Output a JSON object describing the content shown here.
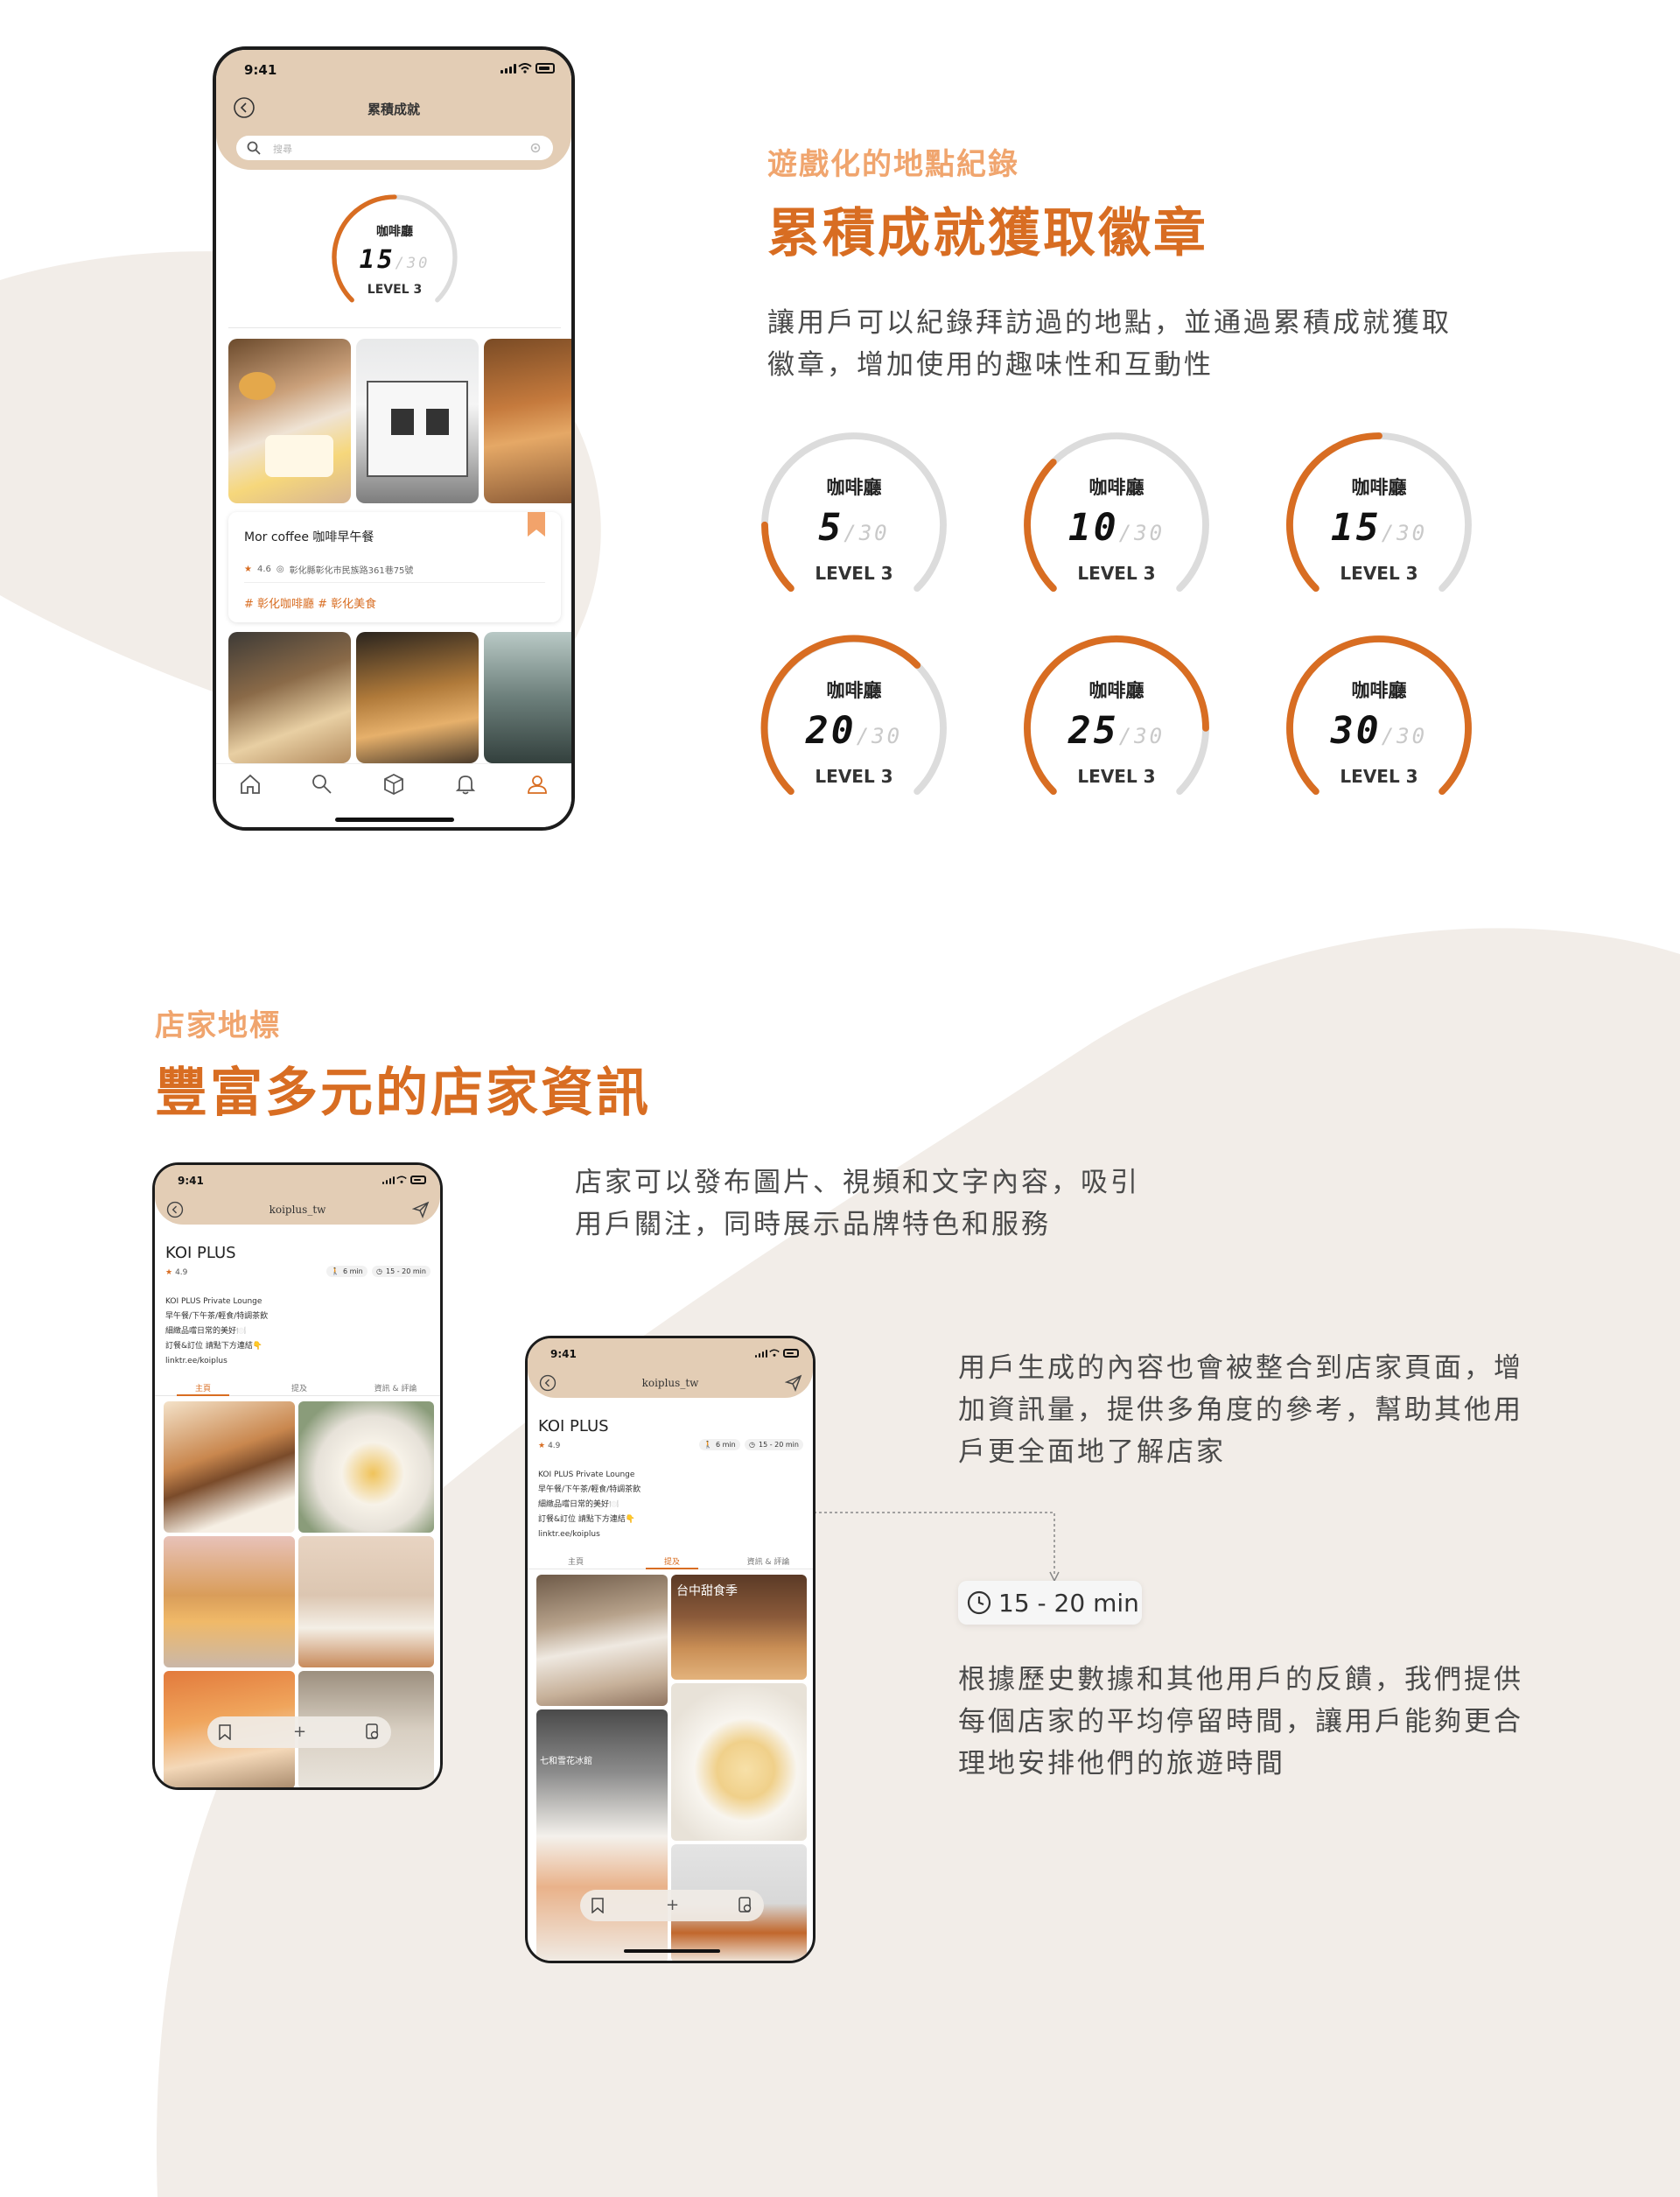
{
  "colors": {
    "accent": "#d86d22",
    "accent_light": "#f0a56e",
    "header_bg": "#e3cdb5",
    "blob": "#f2ede8"
  },
  "section1": {
    "eyebrow": "遊戲化的地點紀錄",
    "title": "累積成就獲取徽章",
    "desc_line1": "讓用戶可以紀錄拜訪過的地點，並通過累積成就獲取",
    "desc_line2": "徽章，增加使用的趣味性和互動性",
    "badges": [
      {
        "label": "咖啡廳",
        "score": "5",
        "total": "/30",
        "level": "LEVEL 3",
        "progress": 0.167
      },
      {
        "label": "咖啡廳",
        "score": "10",
        "total": "/30",
        "level": "LEVEL 3",
        "progress": 0.333
      },
      {
        "label": "咖啡廳",
        "score": "15",
        "total": "/30",
        "level": "LEVEL 3",
        "progress": 0.5
      },
      {
        "label": "咖啡廳",
        "score": "20",
        "total": "/30",
        "level": "LEVEL 3",
        "progress": 0.667
      },
      {
        "label": "咖啡廳",
        "score": "25",
        "total": "/30",
        "level": "LEVEL 3",
        "progress": 0.833
      },
      {
        "label": "咖啡廳",
        "score": "30",
        "total": "/30",
        "level": "LEVEL 3",
        "progress": 1.0
      }
    ]
  },
  "phone1": {
    "time": "9:41",
    "title": "累積成就",
    "search_placeholder": "搜尋",
    "gauge": {
      "label": "咖啡廳",
      "score": "15",
      "total": "/30",
      "level": "LEVEL 3",
      "progress": 0.5
    },
    "card": {
      "name": "Mor coffee 咖啡早午餐",
      "rating": "4.6",
      "address": "彰化縣彰化市民族路361巷75號",
      "tags": "# 彰化咖啡廳  # 彰化美食"
    },
    "nav": [
      "home-icon",
      "search-icon",
      "box-icon",
      "bell-icon",
      "user-icon"
    ]
  },
  "section2": {
    "eyebrow": "店家地標",
    "title": "豐富多元的店家資訊",
    "desc_line1": "店家可以發布圖片、視頻和文字內容，吸引",
    "desc_line2": "用戶關注，同時展示品牌特色和服務",
    "ugc_line1": "用戶生成的內容也會被整合到店家頁面，增",
    "ugc_line2": "加資訊量，提供多角度的參考，幫助其他用",
    "ugc_line3": "戶更全面地了解店家",
    "callout": "15 - 20 min",
    "stay_line1": "根據歷史數據和其他用戶的反饋，我們提供",
    "stay_line2": "每個店家的平均停留時間，讓用戶能夠更合",
    "stay_line3": "理地安排他們的旅遊時間"
  },
  "store": {
    "time": "9:41",
    "handle": "koiplus_tw",
    "name": "KOI PLUS",
    "rating": "4.9",
    "walk": "6 min",
    "stay": "15 - 20 min",
    "bio1": "KOI PLUS Private Lounge",
    "bio2": "早午餐/下午茶/輕食/特調茶飲",
    "bio3": "細緻品嚐日常的美好🍽️",
    "bio4": "訂餐&訂位 請點下方連結👇",
    "link": "linktr.ee/koiplus",
    "tabs": [
      "主頁",
      "提及",
      "資訊 & 評論"
    ],
    "photo_text_a": "台中甜食季",
    "photo_text_b": "七和雪花冰館",
    "plus": "+"
  }
}
